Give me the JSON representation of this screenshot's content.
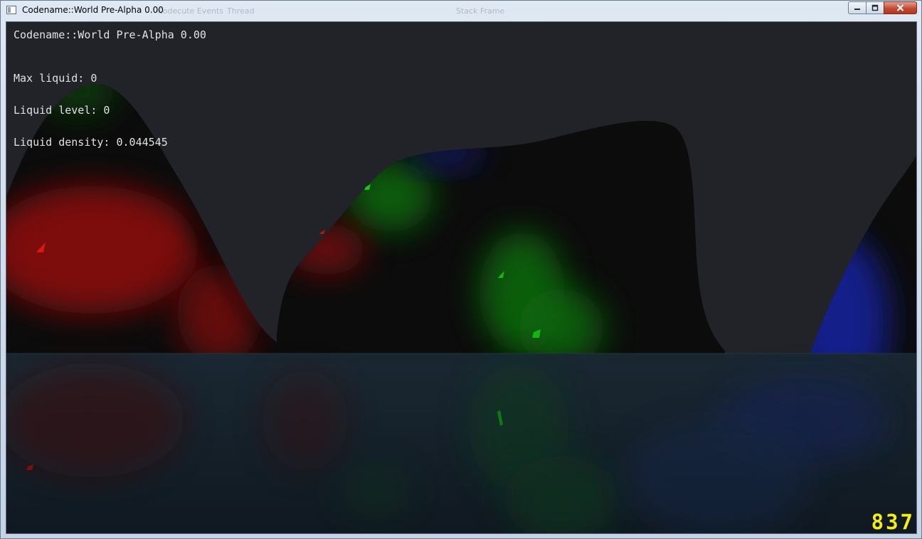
{
  "window": {
    "title": "Codename::World Pre-Alpha 0.00",
    "ghost_labels": [
      "Codecute Events",
      "Thread",
      "Stack Frame"
    ],
    "controls": {
      "minimize_icon": "minimize-icon",
      "maximize_icon": "maximize-icon",
      "close_icon": "close-icon"
    }
  },
  "hud": {
    "title": "Codename::World Pre-Alpha 0.00",
    "stats": [
      "Max liquid: 0",
      "Liquid level: 0",
      "Liquid density: 0.044545"
    ]
  },
  "fps_counter": "837",
  "colors": {
    "sky": "#222229",
    "water": "#13202a",
    "terrain": "#0c0c0c",
    "red_glow": "#b4120e",
    "green_glow": "#16a416",
    "blue_glow": "#1f2bb0",
    "hud_text": "#e2e2e2",
    "fps_text": "#f3ee15"
  }
}
